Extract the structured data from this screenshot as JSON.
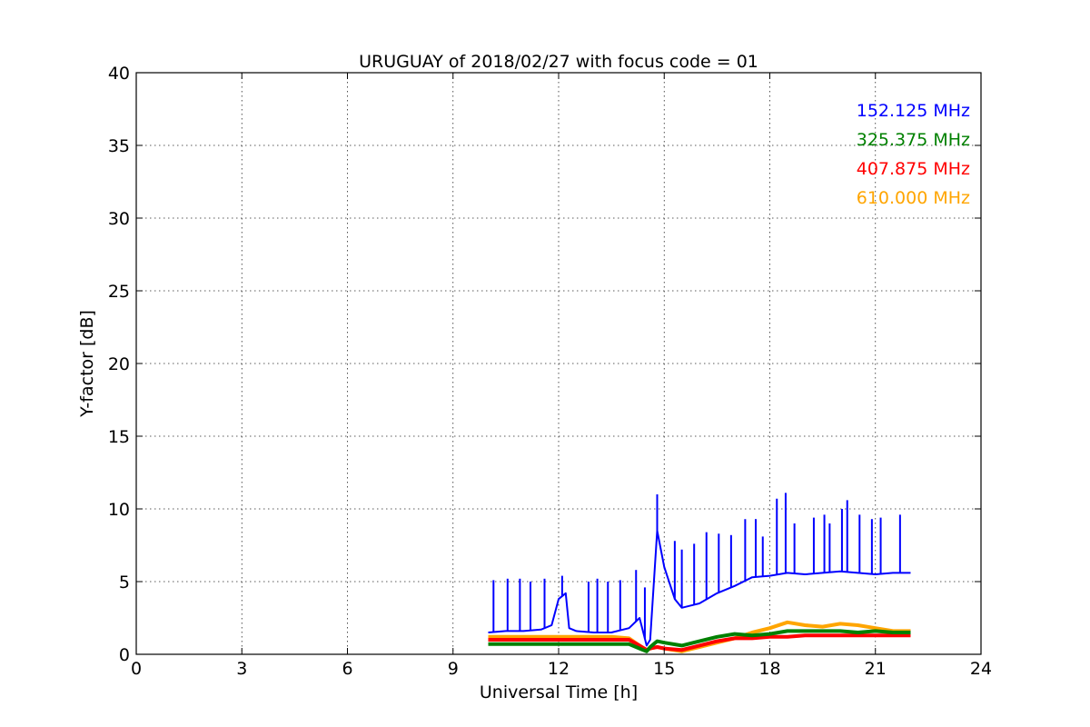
{
  "chart_data": {
    "type": "line",
    "title": "URUGUAY of 2018/02/27 with focus code = 01",
    "xlabel": "Universal Time [h]",
    "ylabel": "Y-factor [dB]",
    "xlim": [
      0,
      24
    ],
    "ylim": [
      0,
      40
    ],
    "xticks": [
      0,
      3,
      6,
      9,
      12,
      15,
      18,
      21,
      24
    ],
    "yticks": [
      0,
      5,
      10,
      15,
      20,
      25,
      30,
      35,
      40
    ],
    "grid": true,
    "legend_position": "top-right",
    "series": [
      {
        "name": "152.125 MHz",
        "color": "#0000ff",
        "x": [
          10.0,
          10.5,
          11.0,
          11.5,
          11.8,
          12.0,
          12.2,
          12.3,
          12.5,
          13.0,
          13.5,
          14.0,
          14.3,
          14.5,
          14.6,
          14.8,
          15.0,
          15.3,
          15.5,
          16.0,
          16.5,
          17.0,
          17.5,
          18.0,
          18.5,
          19.0,
          19.5,
          20.0,
          20.5,
          21.0,
          21.5,
          22.0
        ],
        "y": [
          1.5,
          1.6,
          1.6,
          1.7,
          2.0,
          3.8,
          4.2,
          1.8,
          1.6,
          1.5,
          1.5,
          1.8,
          2.5,
          0.6,
          1.0,
          8.5,
          6.0,
          3.8,
          3.2,
          3.5,
          4.2,
          4.7,
          5.3,
          5.4,
          5.6,
          5.5,
          5.6,
          5.7,
          5.6,
          5.5,
          5.6,
          5.6
        ],
        "spikes": [
          {
            "x": 10.15,
            "y": 5.1
          },
          {
            "x": 10.55,
            "y": 5.2
          },
          {
            "x": 10.9,
            "y": 5.2
          },
          {
            "x": 11.2,
            "y": 5.0
          },
          {
            "x": 11.6,
            "y": 5.2
          },
          {
            "x": 12.1,
            "y": 5.4
          },
          {
            "x": 12.85,
            "y": 5.0
          },
          {
            "x": 13.1,
            "y": 5.2
          },
          {
            "x": 13.4,
            "y": 5.0
          },
          {
            "x": 13.75,
            "y": 5.1
          },
          {
            "x": 14.2,
            "y": 5.8
          },
          {
            "x": 14.45,
            "y": 4.6
          },
          {
            "x": 14.8,
            "y": 11.0
          },
          {
            "x": 15.3,
            "y": 7.8
          },
          {
            "x": 15.5,
            "y": 7.2
          },
          {
            "x": 15.85,
            "y": 7.6
          },
          {
            "x": 16.2,
            "y": 8.4
          },
          {
            "x": 16.55,
            "y": 8.3
          },
          {
            "x": 16.9,
            "y": 8.2
          },
          {
            "x": 17.3,
            "y": 9.3
          },
          {
            "x": 17.6,
            "y": 9.3
          },
          {
            "x": 17.8,
            "y": 8.1
          },
          {
            "x": 18.2,
            "y": 10.7
          },
          {
            "x": 18.45,
            "y": 11.1
          },
          {
            "x": 18.7,
            "y": 9.0
          },
          {
            "x": 19.25,
            "y": 9.4
          },
          {
            "x": 19.55,
            "y": 9.6
          },
          {
            "x": 19.7,
            "y": 9.0
          },
          {
            "x": 20.05,
            "y": 10.0
          },
          {
            "x": 20.2,
            "y": 10.6
          },
          {
            "x": 20.55,
            "y": 9.6
          },
          {
            "x": 20.9,
            "y": 9.3
          },
          {
            "x": 21.15,
            "y": 9.4
          },
          {
            "x": 21.7,
            "y": 9.6
          }
        ]
      },
      {
        "name": "325.375 MHz",
        "color": "#008000",
        "x": [
          10.0,
          10.5,
          11.0,
          11.5,
          12.0,
          12.5,
          13.0,
          13.5,
          14.0,
          14.3,
          14.5,
          14.6,
          14.8,
          15.0,
          15.5,
          16.0,
          16.5,
          17.0,
          17.5,
          18.0,
          18.5,
          19.0,
          19.5,
          20.0,
          20.5,
          21.0,
          21.5,
          22.0
        ],
        "y": [
          0.7,
          0.7,
          0.7,
          0.7,
          0.7,
          0.7,
          0.7,
          0.7,
          0.7,
          0.4,
          0.2,
          0.5,
          0.9,
          0.8,
          0.6,
          0.9,
          1.2,
          1.4,
          1.3,
          1.4,
          1.6,
          1.6,
          1.6,
          1.6,
          1.5,
          1.6,
          1.5,
          1.5
        ]
      },
      {
        "name": "407.875 MHz",
        "color": "#ff0000",
        "x": [
          10.0,
          10.5,
          11.0,
          11.5,
          12.0,
          12.5,
          13.0,
          13.5,
          14.0,
          14.3,
          14.5,
          14.6,
          14.8,
          15.0,
          15.5,
          16.0,
          16.5,
          17.0,
          17.5,
          18.0,
          18.5,
          19.0,
          19.5,
          20.0,
          20.5,
          21.0,
          21.5,
          22.0
        ],
        "y": [
          1.0,
          1.0,
          1.0,
          1.0,
          1.0,
          1.0,
          1.0,
          1.0,
          1.0,
          0.6,
          0.3,
          0.4,
          0.5,
          0.4,
          0.3,
          0.6,
          0.9,
          1.1,
          1.1,
          1.2,
          1.2,
          1.3,
          1.3,
          1.3,
          1.3,
          1.3,
          1.3,
          1.3
        ]
      },
      {
        "name": "610.000 MHz",
        "color": "#ffa500",
        "x": [
          10.0,
          10.5,
          11.0,
          11.5,
          12.0,
          12.5,
          13.0,
          13.5,
          14.0,
          14.3,
          14.5,
          14.6,
          14.8,
          15.0,
          15.5,
          16.0,
          16.5,
          17.0,
          17.5,
          18.0,
          18.5,
          19.0,
          19.5,
          20.0,
          20.5,
          21.0,
          21.5,
          22.0
        ],
        "y": [
          1.2,
          1.2,
          1.2,
          1.2,
          1.2,
          1.2,
          1.2,
          1.2,
          1.1,
          0.6,
          0.3,
          0.4,
          0.5,
          0.4,
          0.2,
          0.5,
          0.8,
          1.1,
          1.5,
          1.8,
          2.2,
          2.0,
          1.9,
          2.1,
          2.0,
          1.8,
          1.6,
          1.6
        ]
      }
    ]
  }
}
